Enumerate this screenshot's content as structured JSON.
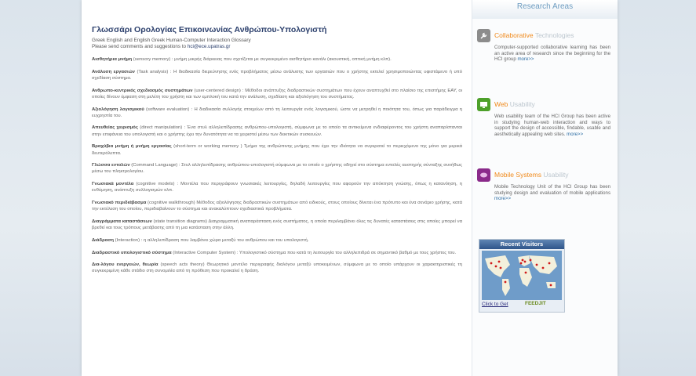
{
  "site": {
    "title": "Γλωσσάρι Ορολογίας Επικοινωνίας Ανθρώπου-Υπολογιστή",
    "subtitle": "Greek English and English Greek Human-Computer Interaction Glossary",
    "contact_text": "Please send comments and suggestions to ",
    "contact_email": "hci@ece.upatras.gr"
  },
  "glossary": [
    {
      "term": "Αισθητήρια μνήμη",
      "en": " (sensory memory)",
      "def": " : μνήμη μικρής διάρκειας που σχετίζεται με συγκεκριμένο αισθητήριο κανάλι (ακουστική, οπτική μνήμη κλπ)."
    },
    {
      "term": "Ανάλυση εργασιών",
      "en": " (Task analysis)",
      "def": " : Η διαδικασία διερεύνησης ενός προβλήματος μέσω ανάλυσης των εργασιών που ο χρήστης εκτελεί χρησιμοποιώντας υφιστάμενο ή υπό σχεδίαση σύστημα."
    },
    {
      "term": "Ανθρωπο-κεντρικός σχεδιασμός συστημάτων",
      "en": " (user-centered design)",
      "def": " : Μέθοδοι ανάπτυξης διαδραστικών συστημάτων που έχουν αναπτυχθεί στο πλαίσιο της επιστήμης ΕΑΥ, οι οποίες δίνουν έμφαση στη μελέτη του χρήστη και των εμπλοκή του κατά την ανάλυση, σχεδίαση και αξιολόγηση του συστήματος."
    },
    {
      "term": "Αξιολόγηση λογισμικού",
      "en": " (software evaluation)",
      "def": " : Η διαδικασία συλλογής στοιχείων από τη λειτουργία ενός λογισμικού, ώστε να μετρηθεί η ποιότητα του, όπως για παράδειγμα η ευχρηστία του."
    },
    {
      "term": "Απευθείας χειρισμός",
      "en": " (direct manipulation)",
      "def": " : Ένα στυλ αλληλεπίδρασης ανθρώπου-υπολογιστή, σύμφωνα με το οποίο τα αντικείμενα ενδιαφέροντος του χρήστη αναπαρίστανται στην επιφάνεια του υπολογιστή και ο χρήστης έχει την δυνατότητα να τα χειριστεί μέσω των δεικτικών συσκευών."
    },
    {
      "term": "Βραχύβια μνήμη ή μνήμη εργασίας",
      "en": " (short-term or working memory )",
      "def": " Τμήμα της ανθρώπινης μνήμης που έχει την ιδιότητα να συγκρατεί το περιεχόμενο της μόνο για μερικά δευτερόλεπτα."
    },
    {
      "term": "Γλώσσα εντολών",
      "en": " (Command Language)",
      "def": " : Στυλ αλληλεπίδρασης ανθρώπου-υπολογιστή σύμφωνα με το οποίο ο χρήστης οδηγεί στο σύστημα εντολές αυστηρής σύνταξης συνήθως μέσω του πληκτρολογίου."
    },
    {
      "term": "Γνωσιακά μοντέλα",
      "en": " (cognitive models)",
      "def": " : Μοντέλα που περιγράφουν γνωσιακές λειτουργίες, δηλαδή λειτουργίες που αφορούν την απόκτηση γνώσης, όπως η κατανόηση, η ενθύμηση, ανάπτυξη συλλογισμών κλπ."
    },
    {
      "term": "Γνωσιακό περιδιάβασμα",
      "en": " (cognitive walkthrough)",
      "def": " Μέθοδος αξιολόγησης διαδραστικών συστημάτων από ειδικούς, στους οποίους δίνεται ένα πρότυπο και ένα σενάριο χρήσης, κατά την εκτέλεση του οποίου, περιδιαβαίνουν το σύστημα και ανακαλύπτουν σχεδιαστικά προβλήματα."
    },
    {
      "term": "Διαγράμματα καταστάσεων",
      "en": " (state transition diagrams)",
      "def": " Διαγραμματική αναπαράσταση ενός συστήματος, η οποία περιλαμβάνει όλες τις δυνατές καταστάσεις στις οποίες μπορεί να βρεθεί και τους τρόπους μετάβασης από τη μια κατάσταση στην άλλη."
    },
    {
      "term": "Διάδραση",
      "en": " (Interaction)",
      "def": " : η αλληλεπίδραση που λαμβάνει χώρα μεταξύ του ανθρώπου και του υπολογιστή."
    },
    {
      "term": "Διαδραστικό υπολογιστικό σύστημα",
      "en": " (Interactive Computer System)",
      "def": " : Υπολογιστικό σύστημα που κατά τη λειτουργία του αλληλεπιδρά σε σημαντικό βαθμό με τους χρήστες του."
    },
    {
      "term": "Δια-λόγου ενεργειών, θεωρία",
      "en": " (speech acts theory)",
      "def": " Θεωρητικό μοντέλο περιγραφής διαλόγου μεταξύ υποκειμένων, σύμφωνα με το οποίο υπάρχουν οι χαρακτηριστικές τη συγκεκριμένη κάθε στάδιο στη συνομιλία από τη πρόθεση που προκαλεί η δράση."
    }
  ],
  "sidebar": {
    "header": "Research Areas",
    "areas": [
      {
        "highlight": "Collaborative",
        "rest": " Technologies",
        "highlight_color": "#f08a1c",
        "icon": "wrench-icon",
        "icon_color": "#8c8c8c",
        "text": "Computer-supported collaborative learning has been an active area of research since the beginning for the HCI group ",
        "more": "more>>"
      },
      {
        "highlight": "Web",
        "rest": " Usability",
        "highlight_color": "#f08a1c",
        "icon": "monitor-icon",
        "icon_color": "#4da02a",
        "text": "Web usability team of the HCI Group has been active in studying human-web interaction and ways to support the design of accessible, findable, usable and aesthetically appealing web sites. ",
        "more": "more>>"
      },
      {
        "highlight": "Mobile Systems",
        "rest": " Usability",
        "highlight_color": "#f08a1c",
        "icon": "mobile-icon",
        "icon_color": "#8a2a8a",
        "text": "Mobile Technology Unit of the HCI Group has been studying design and evaluation of mobile applications ",
        "more": "more>>"
      }
    ],
    "visitors": {
      "title": "Recent Visitors",
      "link": "Click to Get",
      "brand": "FEEDJIT"
    }
  }
}
